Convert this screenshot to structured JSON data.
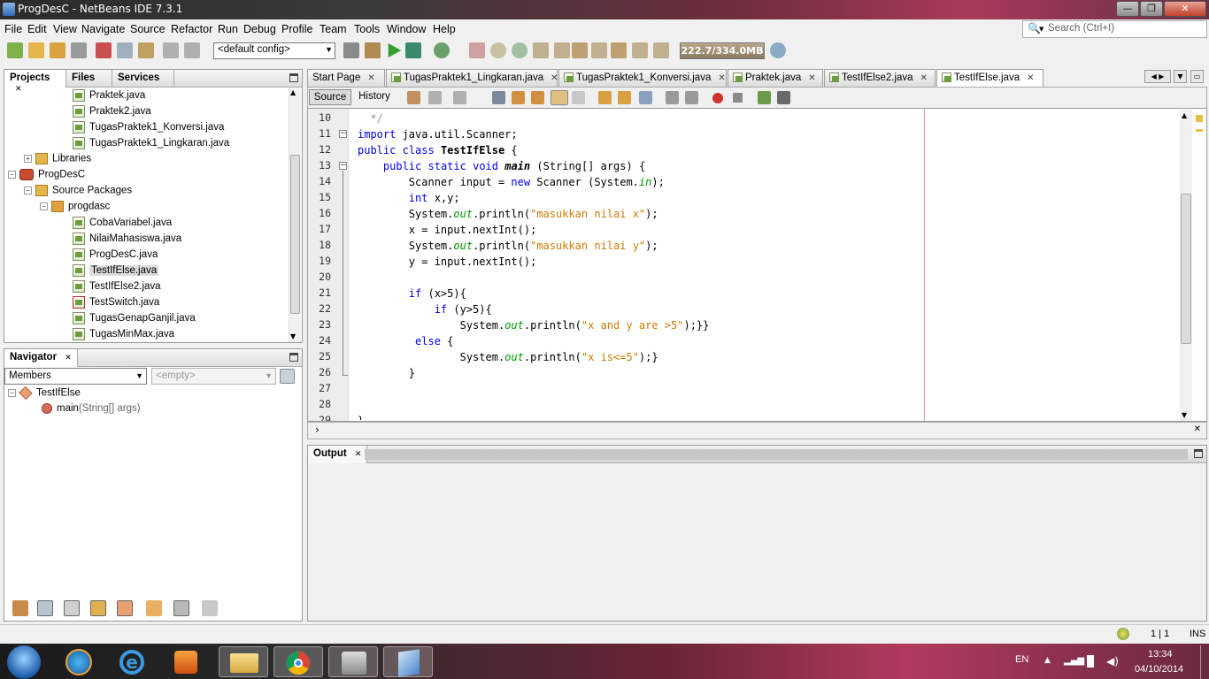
{
  "window": {
    "title": "ProgDesC - NetBeans IDE 7.3.1",
    "min": "—",
    "max": "❐",
    "close": "✕"
  },
  "menu": [
    "File",
    "Edit",
    "View",
    "Navigate",
    "Source",
    "Refactor",
    "Run",
    "Debug",
    "Profile",
    "Team",
    "Tools",
    "Window",
    "Help"
  ],
  "search": {
    "placeholder": "Search (Ctrl+I)"
  },
  "toolbar": {
    "config": "<default config>",
    "memory": "222.7/334.0MB"
  },
  "projects_panel": {
    "tabs": [
      "Projects",
      "Files",
      "Services"
    ],
    "items": [
      {
        "label": "Praktek.java",
        "type": "file"
      },
      {
        "label": "Praktek2.java",
        "type": "file"
      },
      {
        "label": "TugasPraktek1_Konversi.java",
        "type": "file"
      },
      {
        "label": "TugasPraktek1_Lingkaran.java",
        "type": "file"
      },
      {
        "label": "Libraries",
        "type": "lib"
      },
      {
        "label": "ProgDesC",
        "type": "project"
      },
      {
        "label": "Source Packages",
        "type": "pkg"
      },
      {
        "label": "progdasc",
        "type": "pkg"
      },
      {
        "label": "CobaVariabel.java",
        "type": "file"
      },
      {
        "label": "NilaiMahasiswa.java",
        "type": "file"
      },
      {
        "label": "ProgDesC.java",
        "type": "file"
      },
      {
        "label": "TestIfElse.java",
        "type": "file",
        "selected": true
      },
      {
        "label": "TestIfElse2.java",
        "type": "file"
      },
      {
        "label": "TestSwitch.java",
        "type": "file"
      },
      {
        "label": "TugasGenapGanjil.java",
        "type": "file"
      },
      {
        "label": "TugasMinMax.java",
        "type": "file"
      }
    ]
  },
  "navigator": {
    "title": "Navigator",
    "members": "Members",
    "filter": "<empty>",
    "class": "TestIfElse",
    "method": "main",
    "method_args": "(String[] args)"
  },
  "editor": {
    "tabs": [
      "Start Page",
      "TugasPraktek1_Lingkaran.java",
      "TugasPraktek1_Konversi.java",
      "Praktek.java",
      "TestIfElse2.java",
      "TestIfElse.java"
    ],
    "active_tab": "TestIfElse.java",
    "source_btn": "Source",
    "history_btn": "History",
    "line_numbers": [
      "10",
      "11",
      "12",
      "13",
      "14",
      "15",
      "16",
      "17",
      "18",
      "19",
      "20",
      "21",
      "22",
      "23",
      "24",
      "25",
      "26",
      "27",
      "28",
      "29"
    ]
  },
  "output": {
    "title": "Output"
  },
  "status": {
    "position": "1 | 1",
    "mode": "INS"
  },
  "taskbar": {
    "lang": "EN",
    "time": "13:34",
    "date": "04/10/2014"
  },
  "colors": {
    "keyword": "#0000e6",
    "string": "#ce7b00",
    "field": "#009900"
  }
}
